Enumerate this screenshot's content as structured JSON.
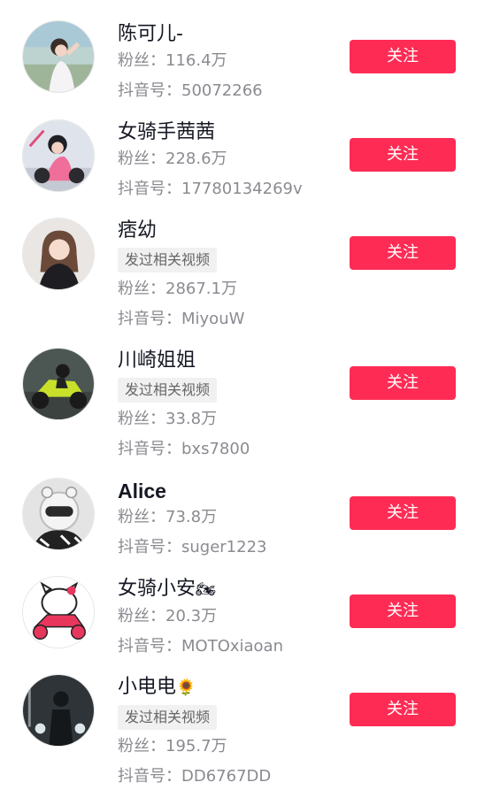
{
  "labels": {
    "fans_prefix": "粉丝：",
    "id_prefix": "抖音号：",
    "follow": "关注",
    "posted_related": "发过相关视频"
  },
  "users": [
    {
      "name": "陈可儿-",
      "fans": "116.4万",
      "douyin_id": "50072266",
      "tag": "",
      "avatar": "girl-outdoors-photo"
    },
    {
      "name": "女骑手茜茜",
      "fans": "228.6万",
      "douyin_id": "17780134269v",
      "tag": "",
      "avatar": "pink-motorcycle-photo"
    },
    {
      "name": "痞幼",
      "fans": "2867.1万",
      "douyin_id": "MiyouW",
      "tag": "发过相关视频",
      "avatar": "girl-portrait-photo"
    },
    {
      "name": "川崎姐姐",
      "fans": "33.8万",
      "douyin_id": "bxs7800",
      "tag": "发过相关视频",
      "avatar": "green-motorcycle-photo"
    },
    {
      "name": "Alice",
      "fans": "73.8万",
      "douyin_id": "suger1223",
      "tag": "",
      "avatar": "helmet-photo"
    },
    {
      "name": "女骑小安",
      "name_emoji": "🏍",
      "fans": "20.3万",
      "douyin_id": "MOTOxiaoan",
      "tag": "",
      "avatar": "hello-kitty-motorcycle"
    },
    {
      "name": "小电电",
      "name_emoji": "🌻",
      "fans": "195.7万",
      "douyin_id": "DD6767DD",
      "tag": "发过相关视频",
      "avatar": "rider-night-photo"
    }
  ]
}
